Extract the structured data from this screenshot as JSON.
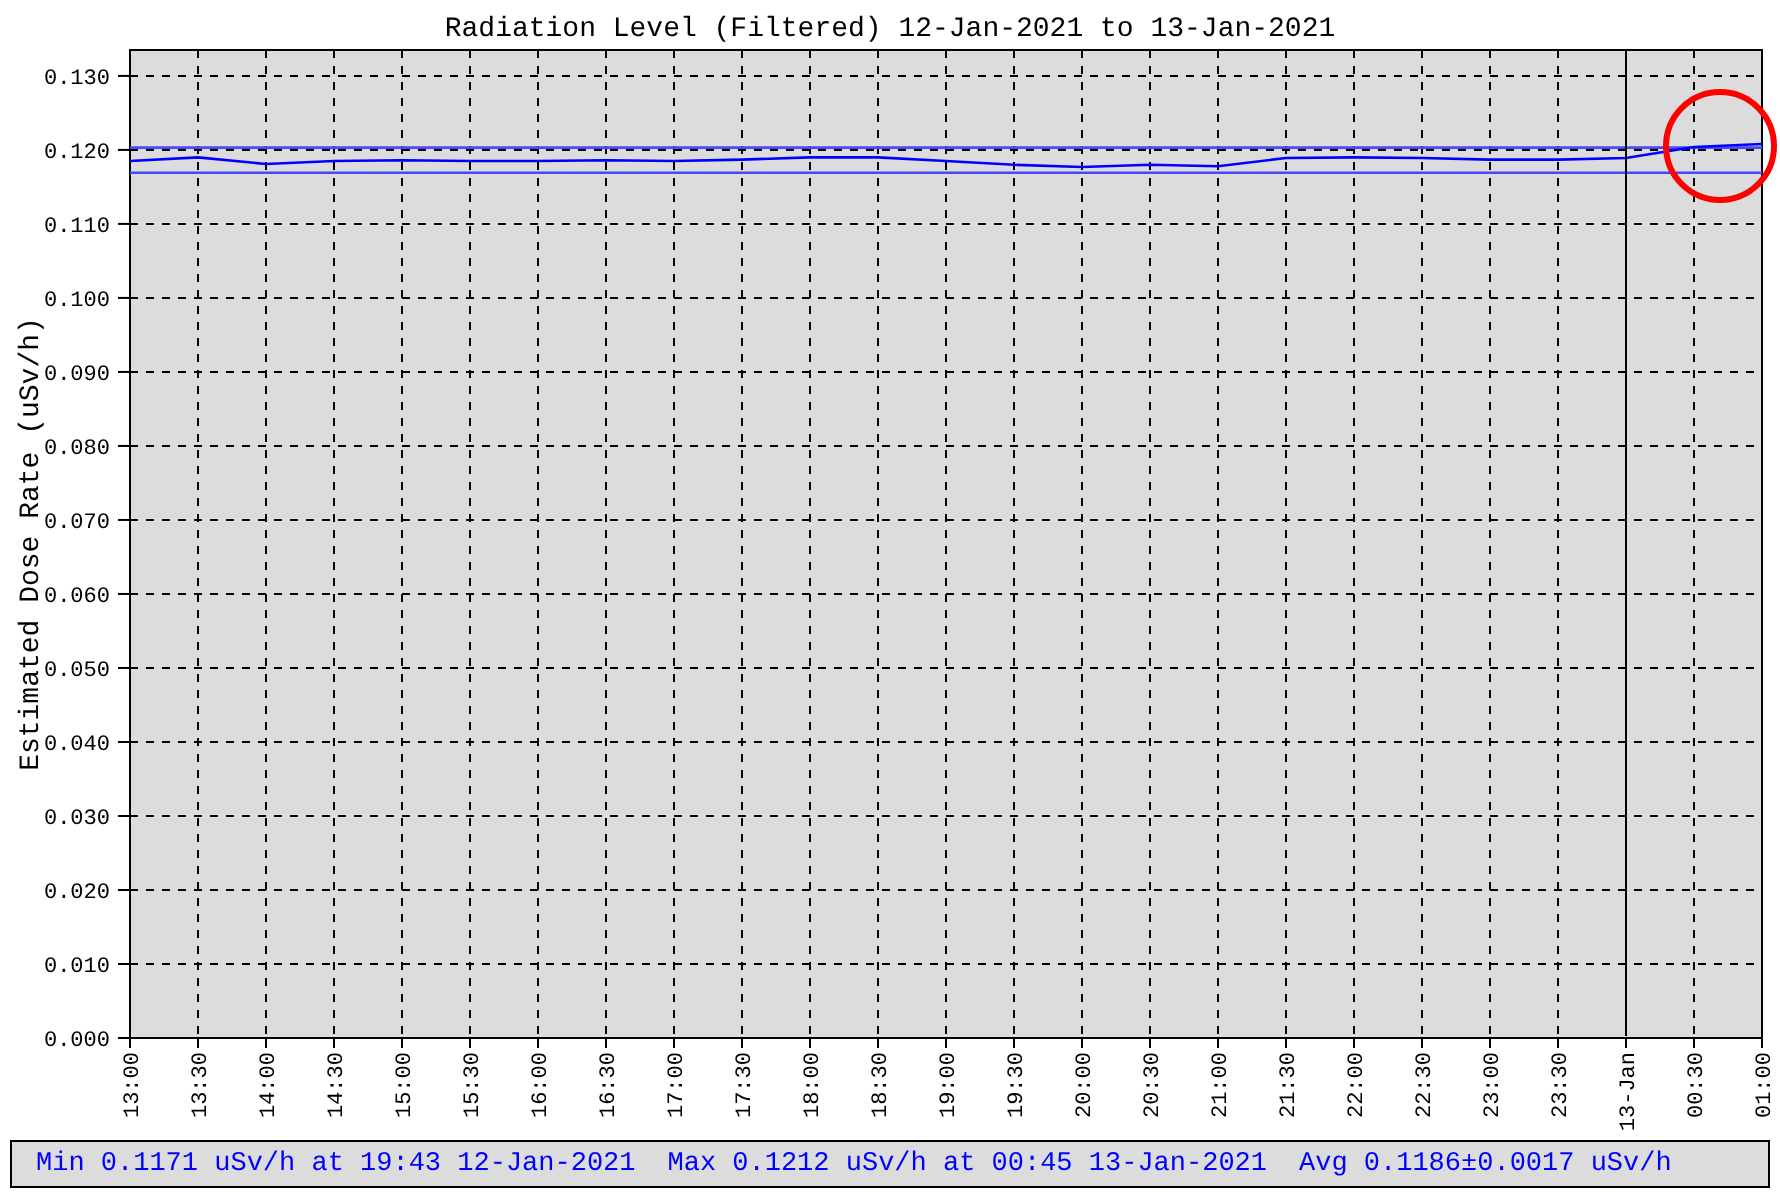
{
  "chart": {
    "chart_data": {
      "type": "line",
      "title": "Radiation Level (Filtered) 12-Jan-2021 to 13-Jan-2021",
      "ylabel": "Estimated Dose Rate (uSv/h)",
      "categories": [
        "13:00",
        "13:30",
        "14:00",
        "14:30",
        "15:00",
        "15:30",
        "16:00",
        "16:30",
        "17:00",
        "17:30",
        "18:00",
        "18:30",
        "19:00",
        "19:30",
        "20:00",
        "20:30",
        "21:00",
        "21:30",
        "22:00",
        "22:30",
        "23:00",
        "23:30",
        "13-Jan",
        "00:30",
        "01:00"
      ],
      "series": [
        {
          "color": "#4848ff",
          "values": [
            0.1203,
            0.1203,
            0.1203,
            0.1203,
            0.1203,
            0.1203,
            0.1203,
            0.1203,
            0.1203,
            0.1203,
            0.1203,
            0.1203,
            0.1203,
            0.1203,
            0.1203,
            0.1203,
            0.1203,
            0.1203,
            0.1203,
            0.1203,
            0.1203,
            0.1203,
            0.1203,
            0.1203,
            0.1203
          ]
        },
        {
          "color": "#4848ff",
          "values": [
            0.1169,
            0.1169,
            0.1169,
            0.1169,
            0.1169,
            0.1169,
            0.1169,
            0.1169,
            0.1169,
            0.1169,
            0.1169,
            0.1169,
            0.1169,
            0.1169,
            0.1169,
            0.1169,
            0.1169,
            0.1169,
            0.1169,
            0.1169,
            0.1169,
            0.1169,
            0.1169,
            0.1169,
            0.1169
          ]
        },
        {
          "color": "#0000ff",
          "values": [
            0.1185,
            0.119,
            0.1181,
            0.1185,
            0.1186,
            0.1185,
            0.1185,
            0.1186,
            0.1185,
            0.1187,
            0.119,
            0.119,
            0.1185,
            0.118,
            0.1177,
            0.118,
            0.1178,
            0.1189,
            0.119,
            0.1189,
            0.1187,
            0.1187,
            0.1189,
            0.1204,
            0.1208
          ]
        }
      ],
      "ylim": [
        0,
        0.1335
      ],
      "grid": true,
      "yticks": [
        {
          "value": 0,
          "label": "0.000"
        },
        {
          "value": 0.01,
          "label": "0.010"
        },
        {
          "value": 0.02,
          "label": "0.020"
        },
        {
          "value": 0.03,
          "label": "0.030"
        },
        {
          "value": 0.04,
          "label": "0.040"
        },
        {
          "value": 0.05,
          "label": "0.050"
        },
        {
          "value": 0.06,
          "label": "0.060"
        },
        {
          "value": 0.07,
          "label": "0.070"
        },
        {
          "value": 0.08,
          "label": "0.080"
        },
        {
          "value": 0.09,
          "label": "0.090"
        },
        {
          "value": 0.1,
          "label": "0.100"
        },
        {
          "value": 0.11,
          "label": "0.110"
        },
        {
          "value": 0.12,
          "label": "0.120"
        },
        {
          "value": 0.13,
          "label": "0.130"
        }
      ]
    }
  },
  "stats": [
    "Min 0.1171 uSv/h at 19:43 12-Jan-2021",
    "Max 0.1212 uSv/h at 00:45 13-Jan-2021",
    "Avg 0.1186±0.0017 uSv/h"
  ]
}
